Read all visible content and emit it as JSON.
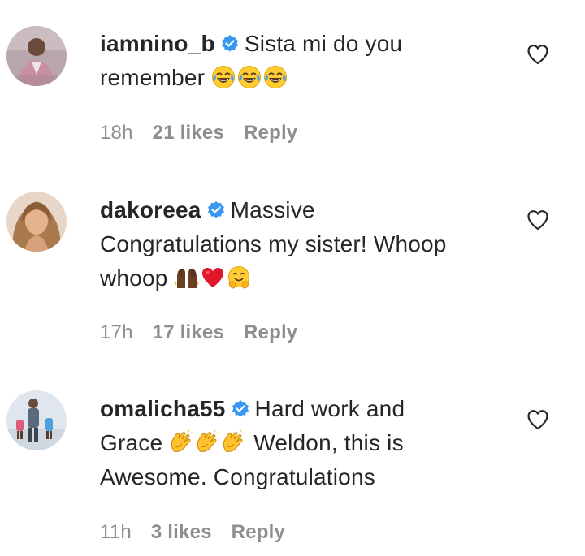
{
  "comments": [
    {
      "username": "iamnino_b",
      "verified": true,
      "text_parts": [
        "Sista mi do you",
        "remember"
      ],
      "emoji": [
        "face-with-tears-of-joy-emoji",
        "face-with-tears-of-joy-emoji",
        "face-with-tears-of-joy-emoji"
      ],
      "time": "18h",
      "likes": "21 likes",
      "reply": "Reply"
    },
    {
      "username": "dakoreea",
      "verified": true,
      "text_parts": [
        "Massive",
        "Congratulations my sister! Whoop",
        "whoop"
      ],
      "emoji": [
        "raising-hands-emoji",
        "red-heart-emoji",
        "hugging-face-emoji"
      ],
      "time": "17h",
      "likes": "17 likes",
      "reply": "Reply"
    },
    {
      "username": "omalicha55",
      "verified": true,
      "text_parts": [
        "Hard work and",
        "Grace",
        "Weldon, this is",
        "Awesome. Congratulations"
      ],
      "emoji": [
        "clapping-hands-emoji",
        "clapping-hands-emoji",
        "clapping-hands-emoji"
      ],
      "time": "11h",
      "likes": "3 likes",
      "reply": "Reply"
    }
  ],
  "colors": {
    "text": "#262626",
    "meta": "#8e8e8e",
    "verified": "#3897f0"
  }
}
